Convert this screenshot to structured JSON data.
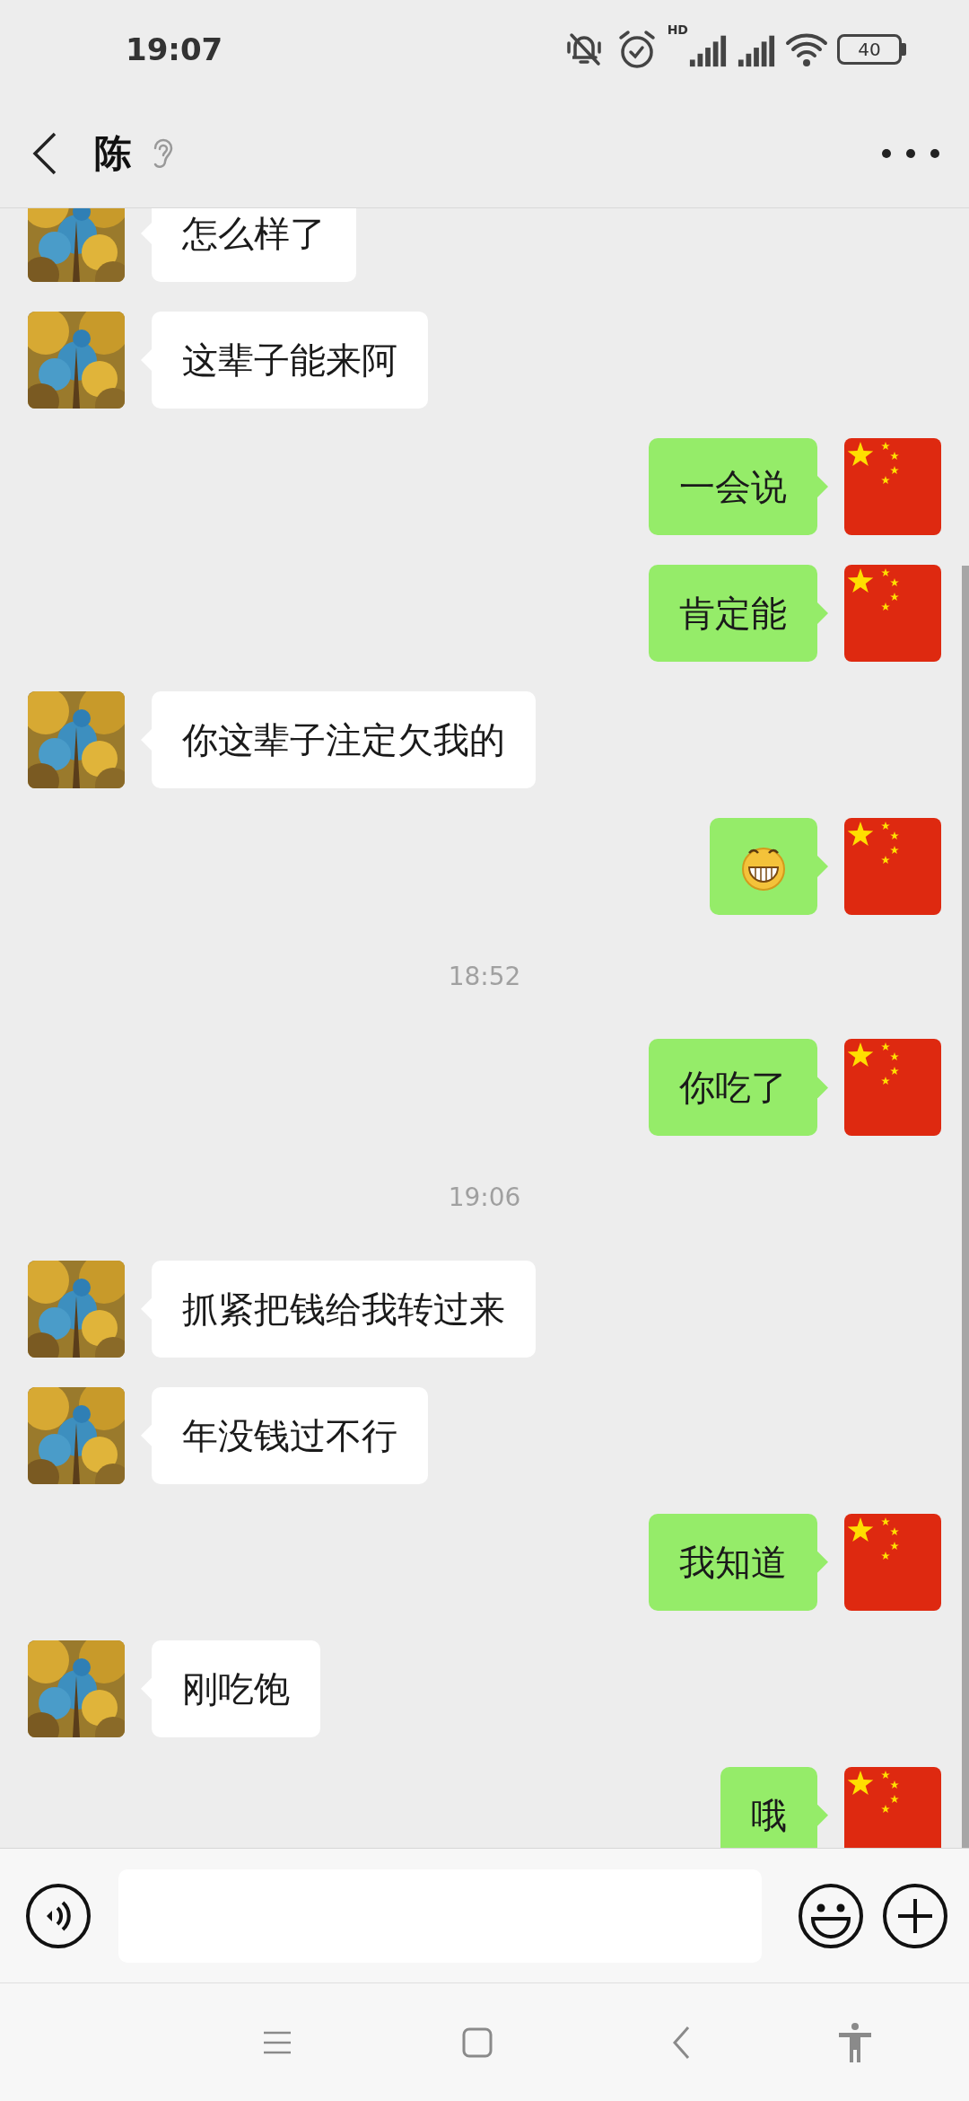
{
  "status_bar": {
    "time": "19:07",
    "network_label": "HD",
    "battery": "40"
  },
  "header": {
    "title": "陈"
  },
  "messages": [
    {
      "kind": "received",
      "text": "怎么样了"
    },
    {
      "kind": "received",
      "text": "这辈子能来阿"
    },
    {
      "kind": "sent",
      "text": "一会说"
    },
    {
      "kind": "sent",
      "text": "肯定能"
    },
    {
      "kind": "received",
      "text": "你这辈子注定欠我的"
    },
    {
      "kind": "sent_emoji"
    },
    {
      "kind": "timestamp",
      "text": "18:52"
    },
    {
      "kind": "sent",
      "text": "你吃了"
    },
    {
      "kind": "timestamp",
      "text": "19:06"
    },
    {
      "kind": "received",
      "text": "抓紧把钱给我转过来"
    },
    {
      "kind": "received",
      "text": "年没钱过不行"
    },
    {
      "kind": "sent",
      "text": "我知道"
    },
    {
      "kind": "received",
      "text": "刚吃饱"
    },
    {
      "kind": "sent",
      "text": "哦"
    }
  ]
}
